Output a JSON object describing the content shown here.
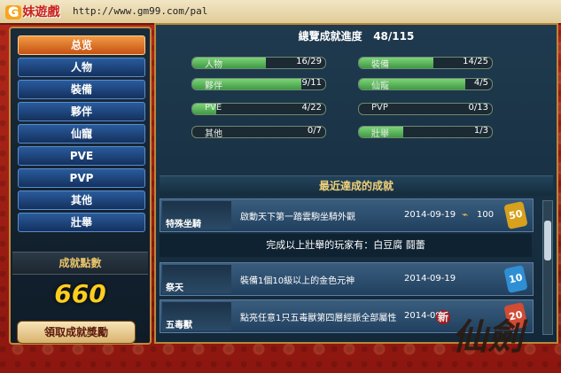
{
  "header": {
    "logo_letter": "G",
    "logo_text": "妹遊戲",
    "url": "http://www.gm99.com/pal"
  },
  "nav": [
    "总览",
    "人物",
    "裝備",
    "夥伴",
    "仙寵",
    "PVE",
    "PVP",
    "其他",
    "壯舉"
  ],
  "points": {
    "title": "成就點數",
    "value": "660"
  },
  "claim_button": "領取成就獎勵",
  "summary": {
    "title": "總覽成就進度",
    "value": "48/115"
  },
  "progress": [
    {
      "label": "人物",
      "value": "16/29",
      "fraction": 0.552
    },
    {
      "label": "裝備",
      "value": "14/25",
      "fraction": 0.56
    },
    {
      "label": "夥伴",
      "value": "9/11",
      "fraction": 0.818
    },
    {
      "label": "仙寵",
      "value": "4/5",
      "fraction": 0.8
    },
    {
      "label": "PVE",
      "value": "4/22",
      "fraction": 0.182
    },
    {
      "label": "PVP",
      "value": "0/13",
      "fraction": 0.0
    },
    {
      "label": "其他",
      "value": "0/7",
      "fraction": 0.0
    },
    {
      "label": "壯舉",
      "value": "1/3",
      "fraction": 0.333
    }
  ],
  "recent": {
    "title": "最近達成的成就"
  },
  "rows": [
    {
      "tag": "特殊坐騎",
      "desc": "啟動天下第一踏雲駒坐騎外觀",
      "date": "2014-09-19",
      "amount": "100",
      "badge": "50",
      "badge_color": "#d7a11d"
    },
    {
      "info": "完成以上壯舉的玩家有：白豆腐 鬪蕾"
    },
    {
      "tag": "祭天",
      "desc": "裝備1個10級以上的金色元神",
      "date": "2014-09-19",
      "amount": "",
      "badge": "10",
      "badge_color": "#2f8fd5"
    },
    {
      "tag": "五毒獸",
      "desc": "點亮任意1只五毒獸第四層經脈全部屬性",
      "date": "2014-09-1",
      "amount": "",
      "badge": "20",
      "badge_color": "#d14b35"
    }
  ],
  "watermark": {
    "text": "仙劍",
    "new": "新"
  }
}
